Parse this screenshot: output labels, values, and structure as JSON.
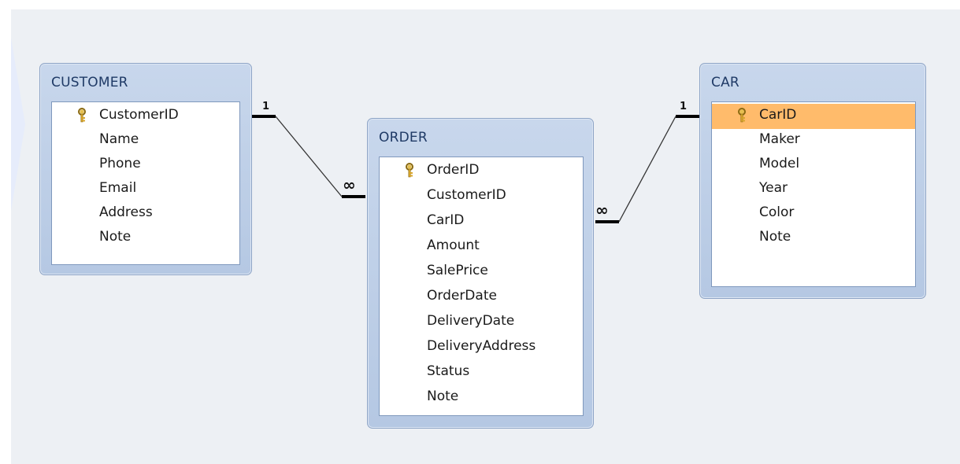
{
  "tables": [
    {
      "id": "customer",
      "title": "CUSTOMER",
      "fields": [
        {
          "name": "CustomerID",
          "key": true
        },
        {
          "name": "Name",
          "key": false
        },
        {
          "name": "Phone",
          "key": false
        },
        {
          "name": "Email",
          "key": false
        },
        {
          "name": "Address",
          "key": false
        },
        {
          "name": "Note",
          "key": false
        }
      ]
    },
    {
      "id": "order",
      "title": "ORDER",
      "fields": [
        {
          "name": "OrderID",
          "key": true
        },
        {
          "name": "CustomerID",
          "key": false
        },
        {
          "name": "CarID",
          "key": false
        },
        {
          "name": "Amount",
          "key": false
        },
        {
          "name": "SalePrice",
          "key": false
        },
        {
          "name": "OrderDate",
          "key": false
        },
        {
          "name": "DeliveryDate",
          "key": false
        },
        {
          "name": "DeliveryAddress",
          "key": false
        },
        {
          "name": "Status",
          "key": false
        },
        {
          "name": "Note",
          "key": false
        }
      ]
    },
    {
      "id": "car",
      "title": "CAR",
      "fields": [
        {
          "name": "CarID",
          "key": true,
          "selected": true
        },
        {
          "name": "Maker",
          "key": false
        },
        {
          "name": "Model",
          "key": false
        },
        {
          "name": "Year",
          "key": false
        },
        {
          "name": "Color",
          "key": false
        },
        {
          "name": "Note",
          "key": false
        }
      ]
    }
  ],
  "relationships": [
    {
      "from": "customer",
      "to": "order",
      "from_label": "1",
      "to_label": "∞"
    },
    {
      "from": "car",
      "to": "order",
      "from_label": "1",
      "to_label": "∞"
    }
  ],
  "colors": {
    "canvas": "#edf0f4",
    "table_frame": "#b5c8e3",
    "title_text": "#1f3a66",
    "selected_row": "#ffbb6b",
    "key_icon": "#d9a62c"
  },
  "icons": {
    "primary_key": "key-icon"
  }
}
